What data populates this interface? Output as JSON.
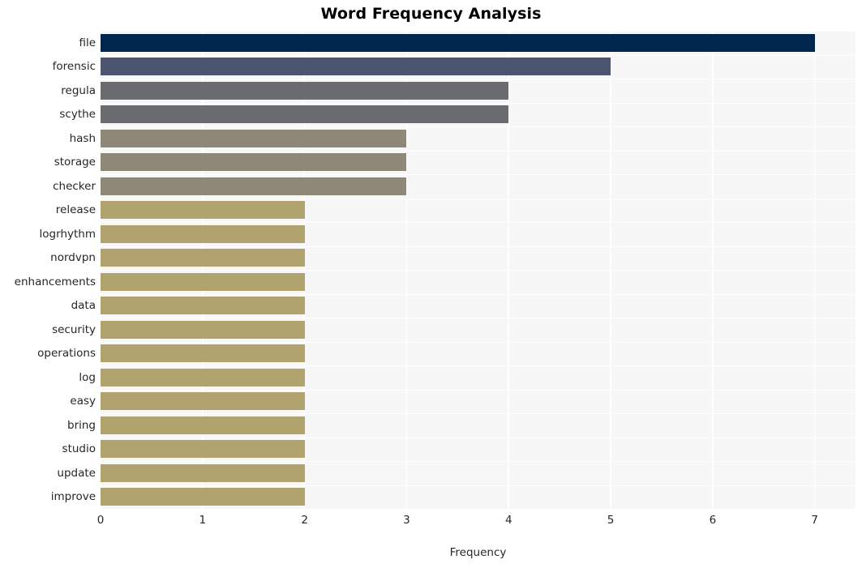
{
  "chart_data": {
    "type": "bar",
    "orientation": "horizontal",
    "title": "Word Frequency Analysis",
    "xlabel": "Frequency",
    "ylabel": "",
    "xlim": [
      0,
      7.4
    ],
    "grid": true,
    "legend": null,
    "style": "whitegrid",
    "xticks": [
      "0",
      "1",
      "2",
      "3",
      "4",
      "5",
      "6",
      "7"
    ],
    "xtick_values": [
      0,
      1,
      2,
      3,
      4,
      5,
      6,
      7
    ],
    "categories": [
      "file",
      "forensic",
      "regula",
      "scythe",
      "hash",
      "storage",
      "checker",
      "release",
      "logrhythm",
      "nordvpn",
      "enhancements",
      "data",
      "security",
      "operations",
      "log",
      "easy",
      "bring",
      "studio",
      "update",
      "improve"
    ],
    "values": [
      7,
      5,
      4,
      4,
      3,
      3,
      3,
      2,
      2,
      2,
      2,
      2,
      2,
      2,
      2,
      2,
      2,
      2,
      2,
      2
    ],
    "bar_colors": [
      "#00264d",
      "#4d5470",
      "#6a6c70",
      "#6a6c70",
      "#8d8878",
      "#8d8878",
      "#8d8878",
      "#b0a36e",
      "#b0a36e",
      "#b0a36e",
      "#b0a36e",
      "#b0a36e",
      "#b0a36e",
      "#b0a36e",
      "#b0a36e",
      "#b0a36e",
      "#b0a36e",
      "#b0a36e",
      "#b0a36e",
      "#b0a36e"
    ],
    "plot_background": "#f7f7f7",
    "gridline_color": "#ffffff",
    "figure_background": "#ffffff",
    "text_color": "#262626"
  }
}
